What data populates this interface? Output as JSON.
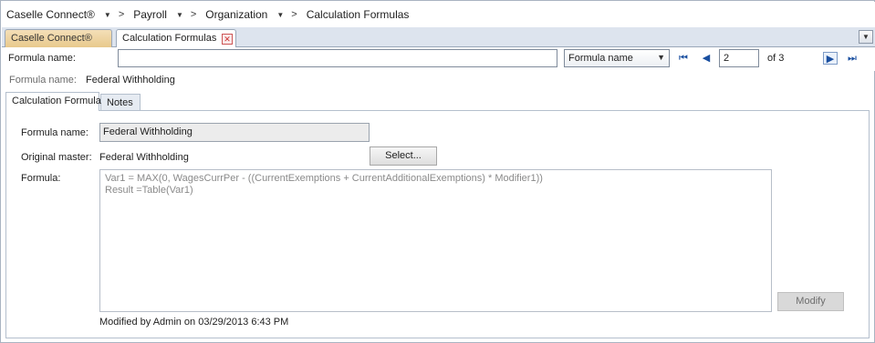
{
  "breadcrumb": {
    "items": [
      {
        "label": "Caselle Connect®",
        "has_dropdown": true
      },
      {
        "label": "Payroll",
        "has_dropdown": true
      },
      {
        "label": "Organization",
        "has_dropdown": true
      },
      {
        "label": "Calculation Formulas",
        "has_dropdown": false
      }
    ],
    "separator": ">"
  },
  "doc_tabs": [
    {
      "label": "Caselle Connect®",
      "active": false
    },
    {
      "label": "Calculation Formulas",
      "active": true,
      "closable": true
    }
  ],
  "search": {
    "label": "Formula name:",
    "value": "",
    "field_select": "Formula name",
    "record_current": "2",
    "record_total_text": "of 3"
  },
  "record": {
    "label": "Formula name:",
    "value": "Federal Withholding"
  },
  "inner_tabs": [
    {
      "label": "Calculation Formula",
      "active": true
    },
    {
      "label": "Notes",
      "active": false
    }
  ],
  "form": {
    "formula_name_label": "Formula name:",
    "formula_name_value": "Federal Withholding",
    "original_master_label": "Original master:",
    "original_master_value": "Federal Withholding",
    "select_button": "Select...",
    "formula_label": "Formula:",
    "formula_text": "Var1 = MAX(0, WagesCurrPer - ((CurrentExemptions + CurrentAdditionalExemptions) * Modifier1))\nResult =Table(Var1)",
    "modify_button": "Modify",
    "modified_text": "Modified by Admin on 03/29/2013 6:43 PM"
  },
  "icons": {
    "first": "first-record-icon",
    "prev": "previous-record-icon",
    "next": "next-record-icon",
    "last": "last-record-icon",
    "close": "close-icon",
    "strip_menu": "chevron-down-icon"
  },
  "colors": {
    "nav_blue": "#1a4fa0",
    "tab_strip": "#dde4ee",
    "inactive_tab": "#e8c98c"
  }
}
